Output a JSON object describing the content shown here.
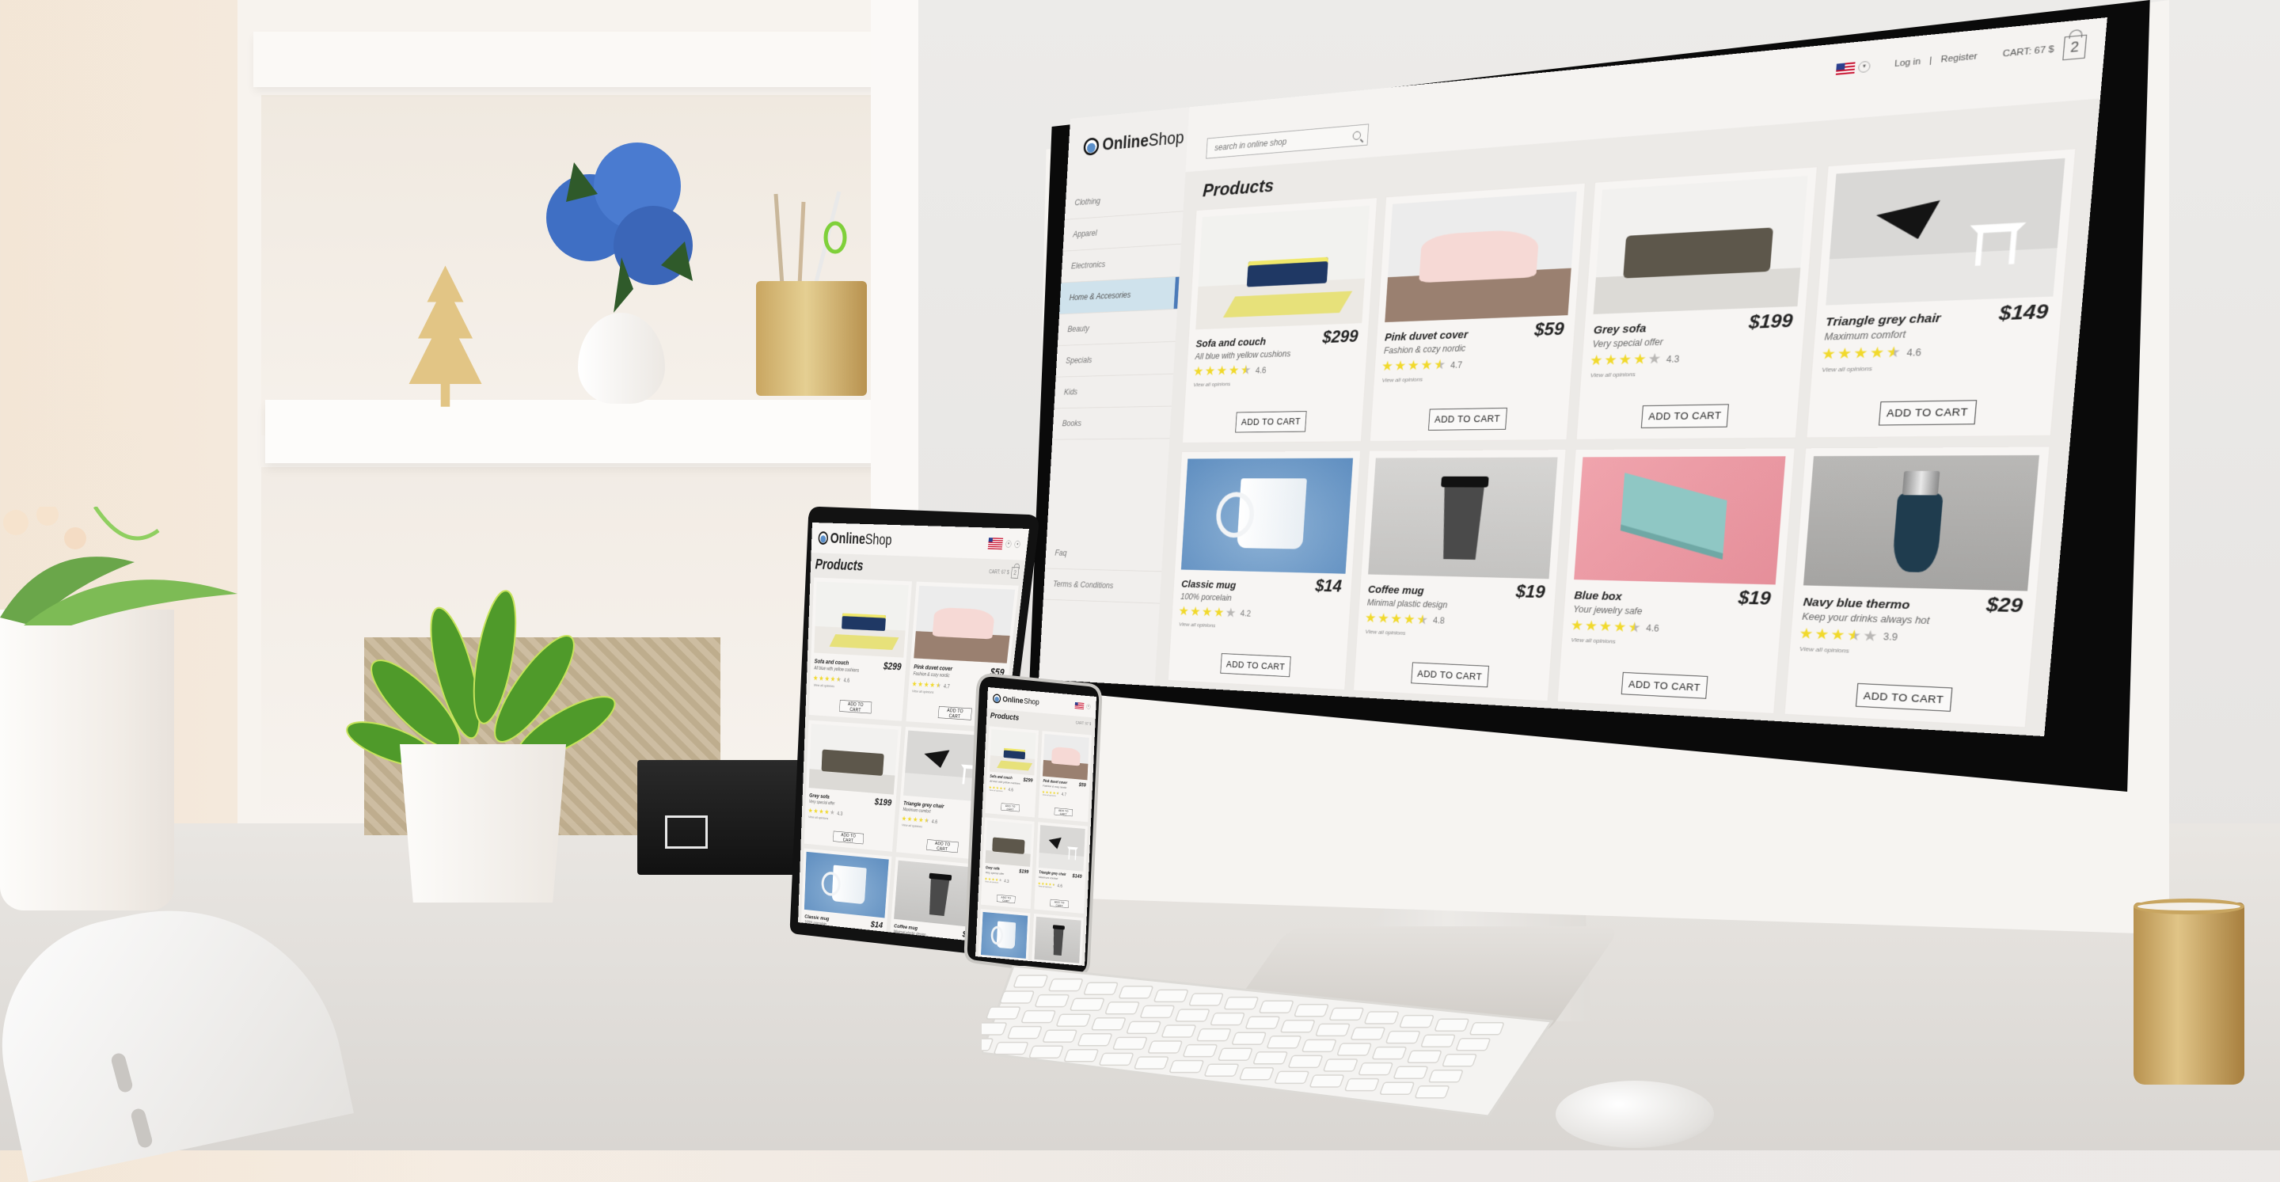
{
  "site": {
    "logo_bold": "Online",
    "logo_light": "Shop",
    "search_placeholder": "search in online shop",
    "login_label": "Log in",
    "separator": "|",
    "register_label": "Register",
    "cart_label": "CART: 67 $",
    "cart_count": "2",
    "language_flag": "us-flag-icon",
    "language_caret": "▾",
    "back_arrow": "◂",
    "page_title": "Products"
  },
  "sidebar": {
    "categories": [
      {
        "label": "Clothing",
        "active": false
      },
      {
        "label": "Apparel",
        "active": false
      },
      {
        "label": "Electronics",
        "active": false
      },
      {
        "label": "Home & Accesories",
        "active": true
      },
      {
        "label": "Beauty",
        "active": false
      },
      {
        "label": "Specials",
        "active": false
      },
      {
        "label": "Kids",
        "active": false
      },
      {
        "label": "Books",
        "active": false
      }
    ],
    "footer_links": [
      {
        "label": "Faq"
      },
      {
        "label": "Terms & Conditions"
      }
    ]
  },
  "products": [
    {
      "name": "Sofa and couch",
      "desc": "All blue with yellow cushions",
      "price": "$299",
      "rating": 4.6,
      "rating_label": "4.6",
      "opinions": "View all opinions",
      "cta": "ADD TO CART",
      "art": "sofa"
    },
    {
      "name": "Pink duvet cover",
      "desc": "Fashion & cozy nordic",
      "price": "$59",
      "rating": 4.7,
      "rating_label": "4.7",
      "opinions": "View all opinions",
      "cta": "ADD TO CART",
      "art": "duvet"
    },
    {
      "name": "Grey sofa",
      "desc": "Very special offer",
      "price": "$199",
      "rating": 4.3,
      "rating_label": "4.3",
      "opinions": "View all opinions",
      "cta": "ADD TO CART",
      "art": "grey"
    },
    {
      "name": "Triangle grey chair",
      "desc": "Maximum comfort",
      "price": "$149",
      "rating": 4.6,
      "rating_label": "4.6",
      "opinions": "View all opinions",
      "cta": "ADD TO CART",
      "art": "chair"
    },
    {
      "name": "Classic mug",
      "desc": "100% porcelain",
      "price": "$14",
      "rating": 4.2,
      "rating_label": "4.2",
      "opinions": "View all opinions",
      "cta": "ADD TO CART",
      "art": "mug"
    },
    {
      "name": "Coffee mug",
      "desc": "Minimal plastic design",
      "price": "$19",
      "rating": 4.8,
      "rating_label": "4.8",
      "opinions": "View all opinions",
      "cta": "ADD TO CART",
      "art": "coffee"
    },
    {
      "name": "Blue box",
      "desc": "Your jewelry safe",
      "price": "$19",
      "rating": 4.6,
      "rating_label": "4.6",
      "opinions": "View all opinions",
      "cta": "ADD TO CART",
      "art": "box"
    },
    {
      "name": "Navy blue thermo",
      "desc": "Keep your drinks always hot",
      "price": "$29",
      "rating": 3.9,
      "rating_label": "3.9",
      "opinions": "View all opinions",
      "cta": "ADD TO CART",
      "art": "thermo"
    }
  ],
  "colors": {
    "star_on": "#f1d92b",
    "star_off": "#b9b7b5",
    "active_category_bg": "#cfe2ec",
    "active_category_accent": "#4a7ab8"
  }
}
